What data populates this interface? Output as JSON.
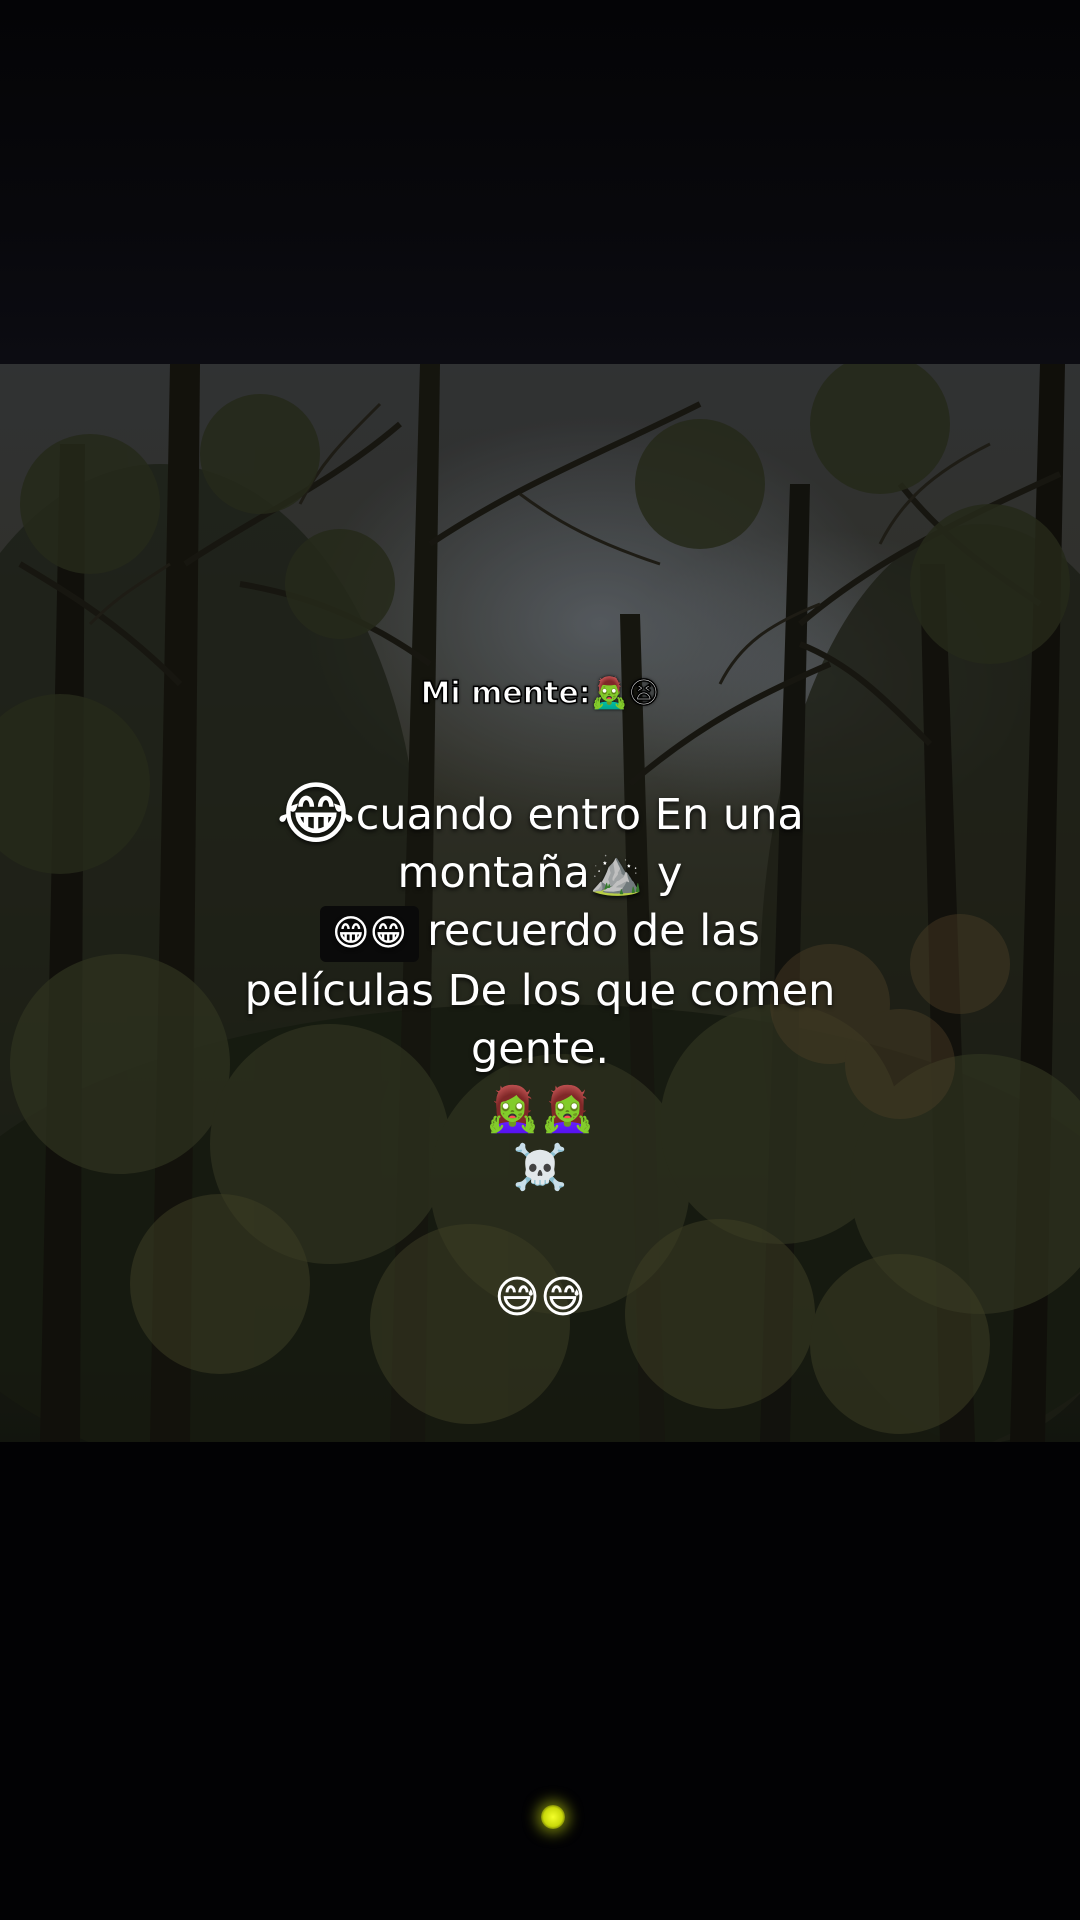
{
  "overlay": {
    "label": "Mi mente:🧟‍♂️😫",
    "line1_emoji": "😂",
    "line1_text": "cuando entro En una",
    "line2_text": "montaña⛰️ y",
    "line3_emoji_box": "😁😁",
    "line3_text": "recuerdo de las",
    "line4_text": "películas De los que comen",
    "line5_text": "gente.",
    "emoji_row1": "🧟‍♀️🧟‍♀️",
    "emoji_row2": "☠️",
    "emoji_row3": "😅😅"
  },
  "colors": {
    "background": "#030305",
    "text": "#ffffff",
    "indicator_dot": "#e8f51a"
  }
}
